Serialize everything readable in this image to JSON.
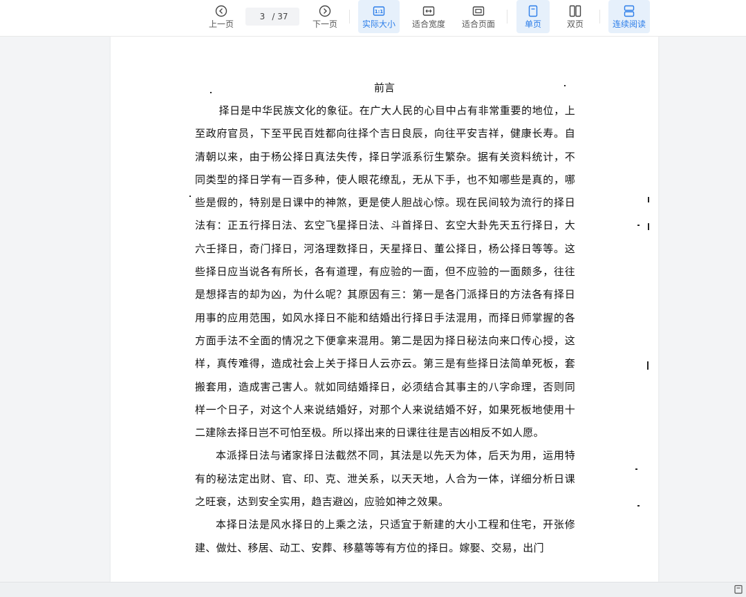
{
  "toolbar": {
    "prev_label": "上一页",
    "next_label": "下一页",
    "current_page": "3",
    "total_pages": "/ 37",
    "actual_size_label": "实际大小",
    "fit_width_label": "适合宽度",
    "fit_page_label": "适合页面",
    "single_page_label": "单页",
    "double_page_label": "双页",
    "continuous_label": "连续阅读",
    "accent_color": "#2b7de9"
  },
  "document": {
    "title": "前言",
    "paragraphs": [
      "择日是中华民族文化的象征。在广大人民的心目中占有非常重要的地位，上至政府官员，下至平民百姓都向往择个吉日良辰，向往平安吉祥，健康长寿。自清朝以来，由于杨公择日真法失传，择日学派系衍生繁杂。据有关资料统计，不同类型的择日学有一百多种，使人眼花缭乱，无从下手，也不知哪些是真的，哪些是假的，特别是日课中的神煞，更是使人胆战心惊。现在民间较为流行的择日法有：正五行择日法、玄空飞星择日法、斗首择日、玄空大卦先天五行择日，大六壬择日，奇门择日，河洛理数择日，天星择日、董公择日，杨公择日等等。这些择日应当说各有所长，各有道理，有应验的一面，但不应验的一面颇多，往往是想择吉的却为凶，为什么呢？其原因有三：第一是各门派择日的方法各有择日用事的应用范围，如风水择日不能和结婚出行择日手法混用，而择日师掌握的各方面手法不全面的情况之下便拿来混用。第二是因为择日秘法向来口传心授，这样，真传难得，造成社会上关于择日人云亦云。第三是有些择日法简单死板，套搬套用，造成害己害人。就如同结婚择日，必须结合其事主的八字命理，否则同样一个日子，对这个人来说结婚好，对那个人来说结婚不好，如果死板地使用十二建除去择日岂不可怕至极。所以择出来的日课往往是吉凶相反不如人愿。",
      "本派择日法与诸家择日法截然不同，其法是以先天为体，后天为用，运用特有的秘法定出财、官、印、克、泄关系，以天天地，人合为一体，详细分析日课之旺衰，达到安全实用，趋吉避凶，应验如神之效果。",
      "本择日法是风水择日的上乘之法，只适宜于新建的大小工程和住宅，开张修建、做灶、移居、动工、安葬、移墓等等有方位的择日。嫁娶、交易，出门"
    ]
  }
}
